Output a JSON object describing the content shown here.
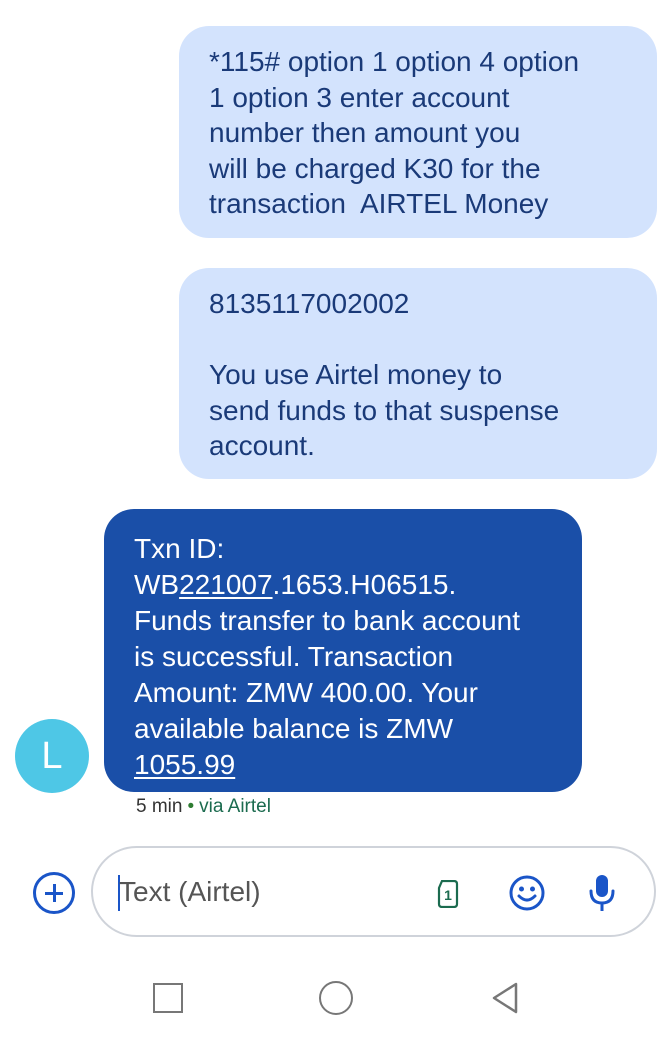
{
  "messages": {
    "out1": {
      "lines": [
        "*115# option 1 option 4 option",
        "1 option 3 enter account",
        "number then amount you",
        "will be charged K30 for the",
        "transaction  AIRTEL Money"
      ]
    },
    "out2": {
      "number": "8135117002002",
      "lines": [
        "You use Airtel money to",
        "send funds to that suspense",
        "account."
      ]
    },
    "in1": {
      "line1": "Txn ID:",
      "id_prefix": "WB",
      "id_link": "221007",
      "id_suffix": ".1653.H06515.",
      "lines": [
        "Funds transfer to bank account",
        "is successful. Transaction",
        "Amount: ZMW 400.00. Your",
        "available balance is ZMW"
      ],
      "balance_link": "1055.99"
    }
  },
  "sender": {
    "avatar_letter": "L",
    "avatar_color": "#4ec7e6"
  },
  "meta": {
    "time": "5 min",
    "separator": "•",
    "via": "via Airtel"
  },
  "composer": {
    "placeholder": "Text (Airtel)",
    "sim_label": "1"
  },
  "icons": {
    "add": "plus-circle-icon",
    "sim": "sim-card-icon",
    "emoji": "emoji-icon",
    "mic": "microphone-icon",
    "nav": [
      "recents-square-icon",
      "home-circle-icon",
      "back-triangle-icon"
    ]
  },
  "colors": {
    "outgoing_bubble": "#d3e3fd",
    "outgoing_text": "#1a3a78",
    "incoming_bubble": "#1a4fa8",
    "accent": "#1a55c8",
    "sim_green": "#1b6b4f"
  }
}
